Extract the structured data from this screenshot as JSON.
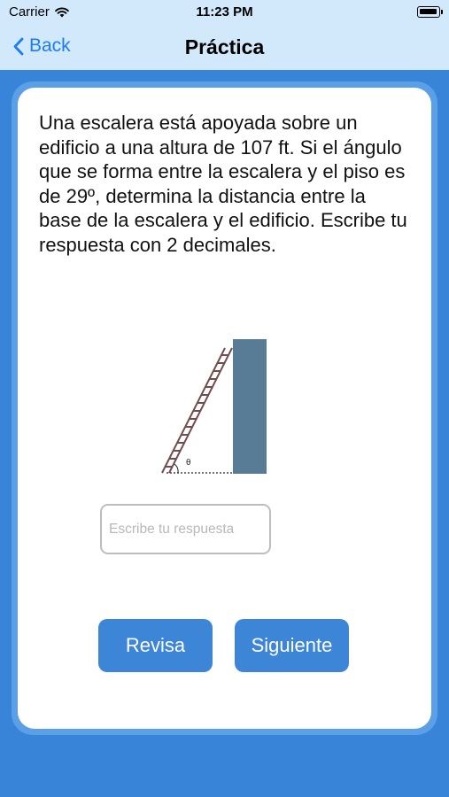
{
  "status_bar": {
    "carrier": "Carrier",
    "time": "11:23 PM",
    "wifi_icon": "wifi-icon",
    "battery_icon": "battery-icon"
  },
  "nav": {
    "back_label": "Back",
    "back_icon": "chevron-left-icon",
    "title": "Práctica"
  },
  "question": {
    "text": "Una escalera está apoyada sobre un edificio a una altura de 107 ft. Si el ángulo que se forma entre la escalera y el piso es de 29º, determina la distancia entre la base de la escalera y el edificio. Escribe tu respuesta con 2 decimales."
  },
  "figure": {
    "angle_label": "θ",
    "building_color": "#587b96",
    "ladder_color": "#734d4d"
  },
  "answer": {
    "value": "",
    "placeholder": "Escribe tu respuesta"
  },
  "buttons": {
    "check_label": "Revisa",
    "next_label": "Siguiente"
  },
  "colors": {
    "background": "#3784d9",
    "nav_background": "#d2e9fb",
    "accent": "#1c7cf6",
    "button": "#3d85d7"
  }
}
